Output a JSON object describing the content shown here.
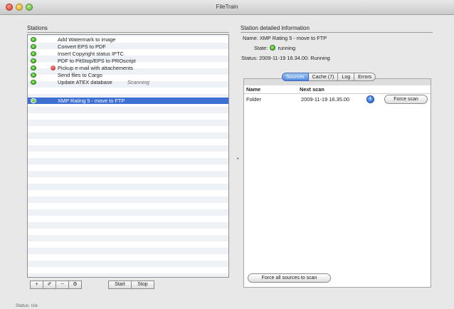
{
  "window": {
    "title": "FileTrain"
  },
  "stations": {
    "heading": "Stations",
    "items": [
      {
        "name": "Add Watermark to image",
        "status": "",
        "error": false,
        "selected": false
      },
      {
        "name": "Convert EPS to PDF",
        "status": "",
        "error": false,
        "selected": false
      },
      {
        "name": "Insert Copyright status IPTC",
        "status": "",
        "error": false,
        "selected": false
      },
      {
        "name": "PDF to PitStop/EPS to PROscript",
        "status": "",
        "error": false,
        "selected": false
      },
      {
        "name": "Pickup e-mail with attachements",
        "status": "",
        "error": true,
        "selected": false
      },
      {
        "name": "Send files to Cargo",
        "status": "",
        "error": false,
        "selected": false
      },
      {
        "name": "Update ATEX database",
        "status": "Scanning",
        "error": false,
        "selected": false
      },
      {
        "name": "XMP Rating 5 - move to FTP",
        "status": "",
        "error": false,
        "selected": true
      }
    ],
    "buttons": {
      "add": "+",
      "edit": "✐",
      "remove": "−",
      "settings": "⚙",
      "start": "Start",
      "stop": "Stop"
    }
  },
  "detail": {
    "heading": "Station detailed information",
    "name_label": "Name:",
    "name_value": "XMP Rating 5 - move to FTP",
    "state_label": "State:",
    "state_value": "running",
    "status_label": "Status:",
    "status_value": "2009-11-19 16.34.00: Running",
    "tabs": [
      "Sources",
      "Cache (7)",
      "Log",
      "Errors"
    ],
    "active_tab": "Sources",
    "columns": {
      "name": "Name",
      "next_scan": "Next scan"
    },
    "rows": [
      {
        "name": "Folder",
        "next_scan": "2009-11-19 16.35.00"
      }
    ],
    "force_scan": "Force scan",
    "force_all": "Force all sources to scan"
  },
  "status_bar": {
    "text": "Status: n/a"
  },
  "colors": {
    "selection": "#3d6fd2",
    "running": "#2f9a18",
    "error": "#b01515",
    "active_tab": "#4f8ae0"
  }
}
